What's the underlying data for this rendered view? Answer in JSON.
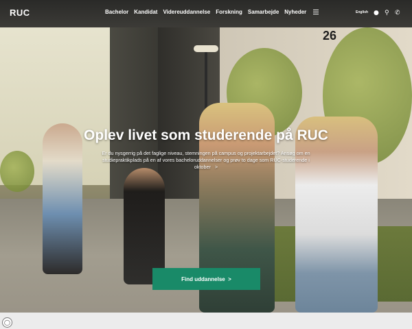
{
  "header": {
    "logo": "RUC",
    "nav": [
      "Bachelor",
      "Kandidat",
      "Videreuddannelse",
      "Forskning",
      "Samarbejde",
      "Nyheder"
    ],
    "lang": "English",
    "icons": [
      "menu-icon",
      "user-icon",
      "search-icon",
      "phone-icon"
    ]
  },
  "hero": {
    "building_number": "26",
    "headline": "Oplev livet som studerende på RUC",
    "subtext": "Er du nysgerrig på det faglige niveau, stemningen på campus og projektarbejdet? Ansøg om en studiepraktikplads på en af vores bacheloruddannelser og prøv to dage som RUC-studerende i oktober",
    "subtext_arrow": ">",
    "cta_label": "Find uddannelse",
    "cta_arrow": ">"
  },
  "colors": {
    "accent": "#198a68"
  }
}
